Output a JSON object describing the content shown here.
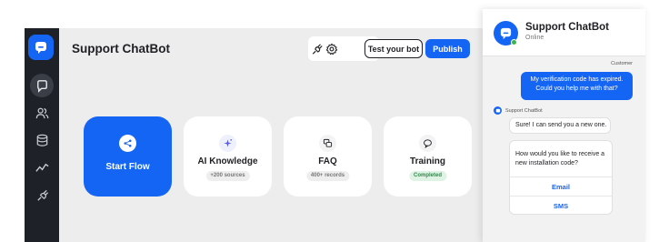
{
  "app": {
    "title": "Support ChatBot",
    "logo_icon": "chat-bubble-icon"
  },
  "sidebar": {
    "items": [
      {
        "name": "conversations",
        "icon": "chat-bubble-icon",
        "active": true
      },
      {
        "name": "contacts",
        "icon": "users-icon",
        "active": false
      },
      {
        "name": "data",
        "icon": "database-icon",
        "active": false
      },
      {
        "name": "analytics",
        "icon": "line-chart-icon",
        "active": false
      },
      {
        "name": "integrations",
        "icon": "plug-icon",
        "active": false
      }
    ]
  },
  "toolbar": {
    "plug_icon": "plug-icon",
    "settings_icon": "gear-icon",
    "test_label": "Test your bot",
    "publish_label": "Publish"
  },
  "cards": [
    {
      "label": "Start Flow",
      "icon": "flow-icon",
      "badge": ""
    },
    {
      "label": "AI Knowledge",
      "icon": "sparkle-icon",
      "badge": "+200 sources"
    },
    {
      "label": "FAQ",
      "icon": "faq-icon",
      "badge": "400+ records"
    },
    {
      "label": "Training",
      "icon": "speech-bubble-icon",
      "badge": "Completed"
    }
  ],
  "chat": {
    "title": "Support ChatBot",
    "status": "Online",
    "customer_label": "Customer",
    "customer_message": "My verification code has expired. Could you help me with that?",
    "bot_label": "Support ChatBot",
    "bot_message": "Sure! I can send you a new one.",
    "question": "How would you like to receive a new installation code?",
    "options": [
      "Email",
      "SMS"
    ]
  },
  "colors": {
    "brand": "#1565f5",
    "sidebar": "#1e2228",
    "online": "#2fb84d",
    "completed_badge": "#2d8a4a"
  }
}
